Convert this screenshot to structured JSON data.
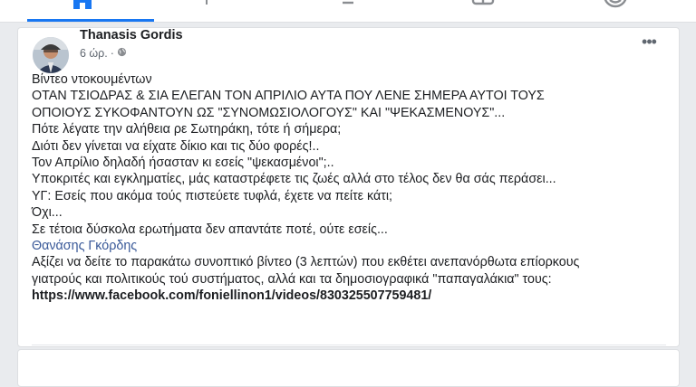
{
  "nav": {
    "tabs": [
      {
        "icon": "home-icon",
        "active": true
      },
      {
        "icon": "watch-icon",
        "active": false
      },
      {
        "icon": "marketplace-icon",
        "active": false
      },
      {
        "icon": "groups-icon",
        "active": false
      },
      {
        "icon": "gaming-icon",
        "active": false
      }
    ],
    "accent_color": "#1877f2"
  },
  "post": {
    "author": "Thanasis Gordis",
    "time": "6 ώρ.",
    "separator": "·",
    "privacy_icon": "globe-icon",
    "more_label": "•••",
    "lines": [
      "Βίντεο ντοκουμέντων",
      "ΟΤΑΝ ΤΣΙΟΔΡΑΣ & ΣΙΑ ΕΛΕΓΑΝ ΤΟΝ ΑΠΡΙΛΙΟ ΑΥΤΑ ΠΟΥ ΛΕΝΕ ΣΗΜΕΡΑ ΑΥΤΟΙ ΤΟΥΣ",
      "ΟΠΟΙΟΥΣ ΣΥΚΟΦΑΝΤΟΥΝ ΩΣ \"ΣΥΝΟΜΩΣΙΟΛΟΓΟΥΣ\" ΚΑΙ \"ΨΕΚΑΣΜΕΝΟΥΣ\"...",
      "Πότε λέγατε την αλήθεια ρε Σωτηράκη, τότε ή σήμερα;",
      "Διότι δεν γίνεται να είχατε δίκιο και τις δύο φορές!..",
      "Τον Απρίλιο δηλαδή ήσασταν κι εσείς \"ψεκασμένοι\";..",
      "Υποκριτές και εγκληματίες, μάς καταστρέφετε τις ζωές αλλά στο τέλος δεν θα σάς περάσει...",
      "ΥΓ: Εσείς που ακόμα τούς πιστεύετε τυφλά, έχετε να πείτε κάτι;",
      "Όχι...",
      "Σε τέτοια δύσκολα ερωτήματα δεν απαντάτε ποτέ, ούτε εσείς..."
    ],
    "mention": "Θανάσης Γκόρδης",
    "after_mention_lines": [
      "Αξίζει να δείτε το παρακάτω συνοπτικό βίντεο (3 λεπτών) που εκθέτει ανεπανόρθωτα επίορκους",
      "γιατρούς και πολιτικούς τού συστήματος, αλλά και τα δημοσιογραφικά \"παπαγαλάκια\" τους:"
    ],
    "link": "https://www.facebook.com/foniellinon1/videos/830325507759481/"
  }
}
